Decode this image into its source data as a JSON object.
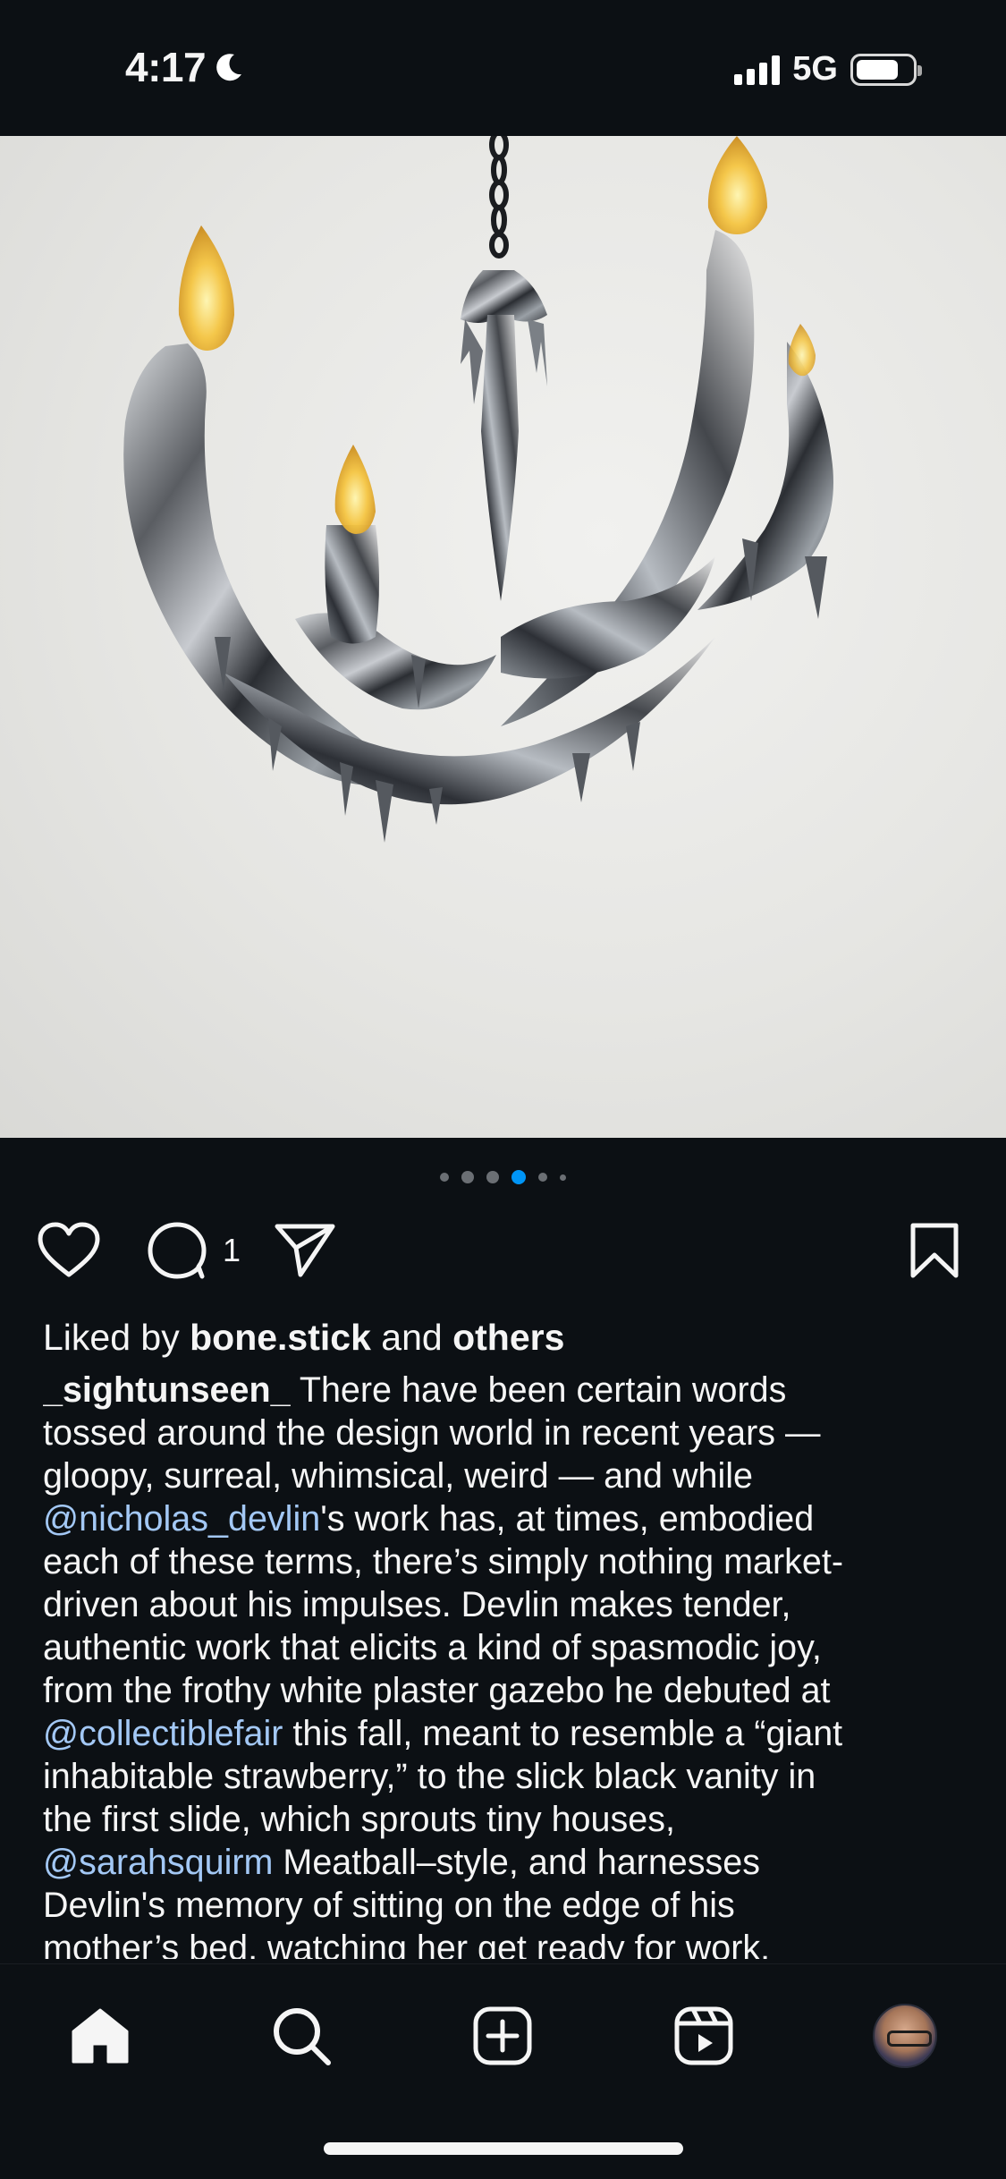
{
  "status_bar": {
    "time": "4:17",
    "network": "5G",
    "icons": [
      "moon-icon",
      "signal-icon",
      "battery-icon"
    ]
  },
  "post": {
    "image_alt": "Chrome drip chandelier with candle bulbs",
    "carousel": {
      "total_dots": 6,
      "active_index": 3
    },
    "comment_count": "1",
    "likes": {
      "prefix": "Liked by ",
      "user": "bone.stick",
      "middle": " and ",
      "others": "others"
    },
    "caption": {
      "username": "_sightunseen_",
      "l1": " There have been certain words",
      "l2": "tossed around the design world in recent years —",
      "l3": "gloopy, surreal, whimsical, weird — and while",
      "l4_mention": "@nicholas_devlin",
      "l4_rest": "'s work has, at times, embodied",
      "l5": "each of these terms, there’s simply nothing market-",
      "l6": "driven about his impulses. Devlin makes tender,",
      "l7": "authentic work that elicits a kind of spasmodic joy,",
      "l8": "from the frothy white plaster gazebo he debuted at",
      "l9_mention": "@collectiblefair",
      "l9_rest": " this fall, meant to resemble a “giant",
      "l10": "inhabitable strawberry,” to the slick black vanity in",
      "l11": "the first slide, which sprouts tiny houses,",
      "l12_mention": "@sarahsquirm",
      "l12_rest": " Meatball–style, and harnesses",
      "l13": "Devlin's memory of sitting on the edge of his",
      "l14": "mother’s bed, watching her get ready for work."
    }
  },
  "nav": {
    "items": [
      "home-icon",
      "search-icon",
      "create-icon",
      "reels-icon",
      "profile-avatar"
    ]
  },
  "colors": {
    "background": "#0c1014",
    "mention": "#a3c8f5",
    "active_dot": "#0095f6"
  }
}
